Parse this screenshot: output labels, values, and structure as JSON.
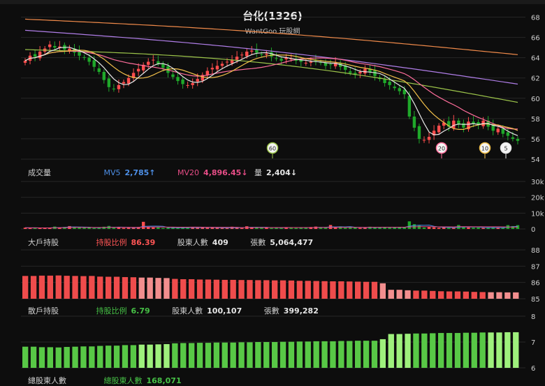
{
  "header": {
    "title": "台化(1326)",
    "brand": "WantGoo 玩股網"
  },
  "colors": {
    "up": "#ff4d4d",
    "down": "#1fa82a",
    "ma5": "#e8e8e8",
    "ma10": "#f2c04a",
    "ma20": "#ff6e9c",
    "ma60": "#9cc44a",
    "ma120": "#b07ee8",
    "ma240": "#f08a4a",
    "big": "#ef4c4c",
    "big_light": "#f28e8e",
    "retail": "#58c846",
    "retail_light": "#9ef07c"
  },
  "chart_data": [
    {
      "type": "candlestick",
      "title": "台化(1326)",
      "ylim": [
        54,
        69
      ],
      "yticks": [
        "68",
        "66",
        "64",
        "62",
        "60",
        "58",
        "56",
        "54"
      ],
      "close": [
        63.7,
        64.2,
        64.1,
        64.6,
        64.9,
        65.3,
        65.0,
        65.1,
        64.8,
        64.9,
        64.5,
        64.2,
        64.0,
        63.6,
        63.1,
        62.6,
        61.8,
        61.1,
        60.9,
        61.3,
        61.6,
        62.0,
        62.5,
        62.9,
        63.3,
        63.6,
        63.8,
        63.4,
        63.0,
        62.5,
        62.1,
        61.7,
        61.4,
        61.3,
        61.5,
        61.9,
        62.3,
        62.7,
        63.0,
        63.2,
        63.4,
        63.6,
        63.8,
        64.1,
        64.3,
        64.6,
        64.7,
        64.5,
        64.3,
        64.4,
        64.1,
        63.9,
        63.7,
        64.0,
        63.9,
        63.7,
        63.6,
        63.5,
        63.6,
        63.7,
        63.5,
        63.2,
        63.3,
        63.5,
        63.1,
        62.8,
        62.5,
        62.3,
        62.6,
        62.9,
        62.6,
        62.2,
        61.9,
        61.5,
        61.3,
        61.0,
        60.7,
        60.4,
        58.2,
        57.1,
        56.0,
        55.9,
        56.2,
        56.8,
        57.3,
        57.6,
        57.2,
        57.8,
        57.4,
        57.1,
        57.7,
        57.5,
        57.4,
        57.8,
        57.2,
        56.8,
        57.0,
        56.5,
        56.3,
        56.0,
        55.8
      ],
      "volume_k": [
        0.8,
        0.6,
        0.7,
        0.5,
        0.6,
        0.8,
        1.5,
        0.9,
        1.2,
        1.8,
        1.1,
        0.9,
        0.7,
        1.0,
        0.6,
        0.8,
        1.4,
        1.9,
        0.7,
        1.0,
        0.6,
        0.8,
        0.9,
        1.2,
        4.5,
        1.3,
        0.9,
        1.0,
        0.6,
        0.7,
        1.1,
        0.6,
        0.8,
        0.9,
        1.3,
        0.7,
        0.9,
        0.8,
        1.0,
        0.7,
        0.6,
        0.5,
        1.4,
        0.8,
        0.6,
        1.7,
        0.9,
        1.2,
        0.8,
        0.7,
        0.6,
        0.9,
        1.0,
        1.1,
        0.8,
        0.6,
        0.7,
        0.9,
        1.2,
        1.5,
        0.8,
        0.7,
        2.5,
        1.0,
        1.6,
        0.7,
        1.2,
        0.9,
        0.6,
        0.8,
        1.4,
        1.0,
        0.9,
        1.2,
        0.8,
        0.9,
        1.1,
        1.0,
        4.8,
        3.0,
        2.0,
        0.9,
        1.5,
        1.0,
        0.7,
        1.0,
        0.8,
        0.6,
        2.5,
        1.2,
        1.0,
        0.8,
        0.9,
        0.6,
        0.8,
        1.0,
        0.9,
        0.7,
        2.4,
        1.8,
        2.4
      ],
      "ma_badges": [
        "60",
        "20",
        "10",
        "5"
      ]
    },
    {
      "type": "bar",
      "title": "成交量",
      "yticks": [
        "20k",
        "10k",
        "0"
      ],
      "ylim_vol": [
        0,
        30
      ],
      "yticks_extra": "30k",
      "legend": {
        "mv5_label": "MV5",
        "mv5_value": "2,785↑",
        "mv20_label": "MV20",
        "mv20_value": "4,896.45↓",
        "vol_label": "量",
        "vol_value": "2,404↓"
      }
    },
    {
      "type": "bar",
      "title": "大戶持股",
      "ylim": [
        85,
        88
      ],
      "yticks": [
        "88",
        "87",
        "86",
        "85"
      ],
      "values": [
        86.4,
        86.4,
        86.42,
        86.42,
        86.43,
        86.41,
        86.4,
        86.39,
        86.4,
        86.36,
        86.35,
        86.35,
        86.33,
        86.32,
        86.3,
        86.3,
        86.28,
        86.27,
        86.22,
        86.2,
        86.2,
        86.18,
        86.18,
        86.17,
        86.16,
        86.16,
        86.15,
        86.15,
        86.14,
        86.14,
        86.13,
        86.13,
        86.12,
        86.1,
        86.1,
        86.09,
        86.08,
        86.07,
        86.07,
        86.06,
        86.05,
        86.04,
        86.04,
        85.95,
        85.55,
        85.55,
        85.52,
        85.5,
        85.5,
        85.48,
        85.46,
        85.45,
        85.45,
        85.44,
        85.42,
        85.41,
        85.4,
        85.4,
        85.39,
        85.39
      ],
      "legend": {
        "ratio_label": "持股比例",
        "ratio_value": "86.39",
        "holders_label": "股東人數",
        "holders_value": "409",
        "shares_label": "張數",
        "shares_value": "5,064,477"
      }
    },
    {
      "type": "bar",
      "title": "散戶持股",
      "ylim": [
        6,
        8
      ],
      "yticks": [
        "8",
        "7",
        "6"
      ],
      "values": [
        6.82,
        6.82,
        6.8,
        6.8,
        6.79,
        6.81,
        6.82,
        6.83,
        6.83,
        6.85,
        6.86,
        6.86,
        6.88,
        6.88,
        6.9,
        6.9,
        6.91,
        6.92,
        6.95,
        6.96,
        6.96,
        6.97,
        6.97,
        6.98,
        6.98,
        6.98,
        6.99,
        6.99,
        7.0,
        7.0,
        7.0,
        7.01,
        7.01,
        7.02,
        7.02,
        7.03,
        7.03,
        7.03,
        7.04,
        7.04,
        7.05,
        7.05,
        7.05,
        7.11,
        7.31,
        7.31,
        7.32,
        7.33,
        7.33,
        7.34,
        7.35,
        7.35,
        7.35,
        7.36,
        7.36,
        7.37,
        7.37,
        7.37,
        7.38,
        7.38
      ],
      "legend": {
        "ratio_label": "持股比例",
        "ratio_value": "6.79",
        "holders_label": "股東人數",
        "holders_value": "100,107",
        "shares_label": "張數",
        "shares_value": "399,282"
      }
    },
    {
      "type": "bar",
      "title": "總股東人數",
      "legend": {
        "holders_label": "總股東人數",
        "holders_value": "168,071"
      }
    }
  ]
}
